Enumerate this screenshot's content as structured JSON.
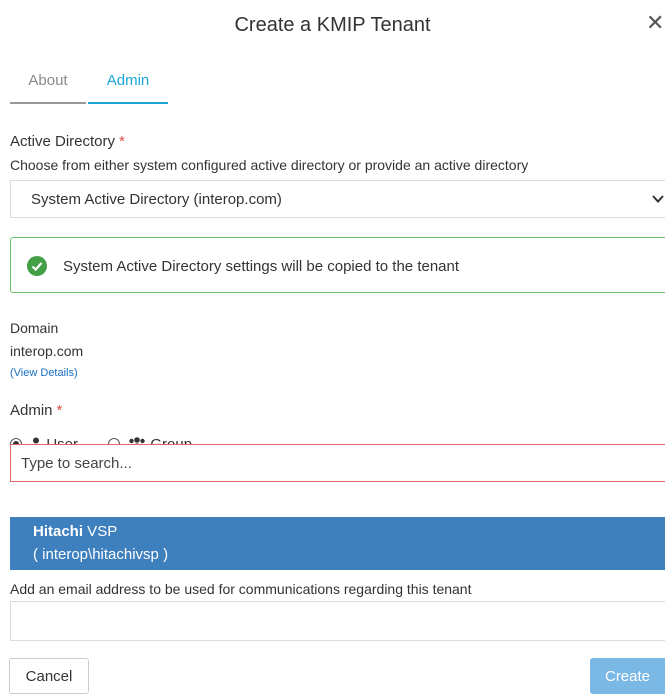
{
  "dialog": {
    "title": "Create a KMIP Tenant",
    "close_icon": "close-icon"
  },
  "tabs": [
    {
      "label": "About",
      "active": false
    },
    {
      "label": "Admin",
      "active": true
    }
  ],
  "active_directory": {
    "label": "Active Directory",
    "required_mark": "*",
    "help": "Choose from either system configured active directory or provide an active directory",
    "selected": "System Active Directory (interop.com)"
  },
  "alert": {
    "icon": "check-circle-icon",
    "text": "System Active Directory settings will be copied to the tenant",
    "color": "#6cc36c"
  },
  "domain": {
    "label": "Domain",
    "value": "interop.com",
    "link_open": "(",
    "link": "View Details",
    "link_close": ")"
  },
  "admin": {
    "label": "Admin",
    "required_mark": "*",
    "options": [
      {
        "label": "User",
        "icon": "user-icon",
        "selected": true
      },
      {
        "label": "Group",
        "icon": "users-icon",
        "selected": false
      }
    ],
    "search_placeholder": "Type to search...",
    "suggestion": {
      "name_bold": "Hitachi",
      "name_rest": " VSP",
      "account": "( interop\\hitachivsp )"
    }
  },
  "email": {
    "help": "Add an email address to be used for communications regarding this tenant",
    "value": ""
  },
  "footer": {
    "cancel_label": "Cancel",
    "create_label": "Create"
  },
  "colors": {
    "accent": "#1aa6d6",
    "highlight": "#3e7fbe",
    "error_border": "#e06666",
    "primary_disabled": "#7ab8e6",
    "required": "#d9534f"
  }
}
